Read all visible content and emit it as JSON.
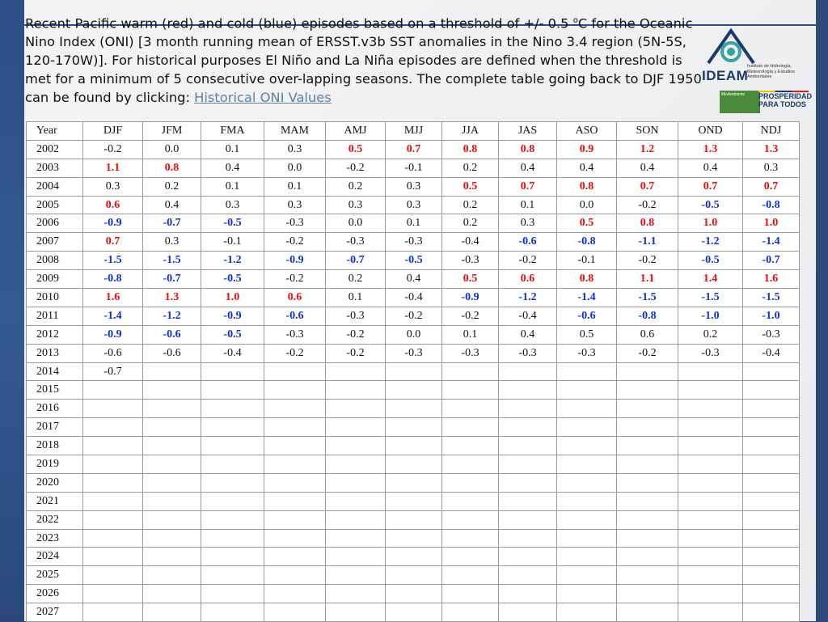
{
  "header": {
    "intro": "Recent Pacific warm (red) and cold (blue) episodes based on a threshold of +/- 0.5 ",
    "degree": "o",
    "rest": "C for the Oceanic Nino Index (ONI) [3 month running mean of ERSST.v3b SST anomalies in the Nino 3.4 region (5N-5S, 120-170W)]. For historical purposes El Niño and La Niña episodes are defined when the threshold is met for a minimum of 5 consecutive over-lapping seasons.  The complete table going back to DJF 1950 can be found by clicking: ",
    "link_label": "Historical ONI Values"
  },
  "logos": {
    "ideam_name": "IDEAM",
    "ideam_sub": "Instituto de Hidrología, Meteorología y Estudios Ambientales",
    "ministry": "MinAmbiente",
    "prosperidad_line1": "PROSPERIDAD",
    "prosperidad_line2": "PARA TODOS"
  },
  "colors": {
    "warm": "#e01010",
    "cold": "#1030d0",
    "link": "#5f7fa3",
    "frame": "#2e4a7a"
  },
  "table": {
    "columns": [
      "Year",
      "DJF",
      "JFM",
      "FMA",
      "MAM",
      "AMJ",
      "MJJ",
      "JJA",
      "JAS",
      "ASO",
      "SON",
      "OND",
      "NDJ"
    ],
    "rows": [
      {
        "year": "2002",
        "cells": [
          [
            "-0.2",
            ""
          ],
          [
            "0.0",
            ""
          ],
          [
            "0.1",
            ""
          ],
          [
            "0.3",
            ""
          ],
          [
            "0.5",
            "warm"
          ],
          [
            "0.7",
            "warm"
          ],
          [
            "0.8",
            "warm"
          ],
          [
            "0.8",
            "warm"
          ],
          [
            "0.9",
            "warm"
          ],
          [
            "1.2",
            "warm"
          ],
          [
            "1.3",
            "warm"
          ],
          [
            "1.3",
            "warm"
          ]
        ]
      },
      {
        "year": "2003",
        "cells": [
          [
            "1.1",
            "warm"
          ],
          [
            "0.8",
            "warm"
          ],
          [
            "0.4",
            ""
          ],
          [
            "0.0",
            ""
          ],
          [
            "-0.2",
            ""
          ],
          [
            "-0.1",
            ""
          ],
          [
            "0.2",
            ""
          ],
          [
            "0.4",
            ""
          ],
          [
            "0.4",
            ""
          ],
          [
            "0.4",
            ""
          ],
          [
            "0.4",
            ""
          ],
          [
            "0.3",
            ""
          ]
        ]
      },
      {
        "year": "2004",
        "cells": [
          [
            "0.3",
            ""
          ],
          [
            "0.2",
            ""
          ],
          [
            "0.1",
            ""
          ],
          [
            "0.1",
            ""
          ],
          [
            "0.2",
            ""
          ],
          [
            "0.3",
            ""
          ],
          [
            "0.5",
            "warm"
          ],
          [
            "0.7",
            "warm"
          ],
          [
            "0.8",
            "warm"
          ],
          [
            "0.7",
            "warm"
          ],
          [
            "0.7",
            "warm"
          ],
          [
            "0.7",
            "warm"
          ]
        ]
      },
      {
        "year": "2005",
        "cells": [
          [
            "0.6",
            "warm"
          ],
          [
            "0.4",
            ""
          ],
          [
            "0.3",
            ""
          ],
          [
            "0.3",
            ""
          ],
          [
            "0.3",
            ""
          ],
          [
            "0.3",
            ""
          ],
          [
            "0.2",
            ""
          ],
          [
            "0.1",
            ""
          ],
          [
            "0.0",
            ""
          ],
          [
            "-0.2",
            ""
          ],
          [
            "-0.5",
            "cold"
          ],
          [
            "-0.8",
            "cold"
          ]
        ]
      },
      {
        "year": "2006",
        "cells": [
          [
            "-0.9",
            "cold"
          ],
          [
            "-0.7",
            "cold"
          ],
          [
            "-0.5",
            "cold"
          ],
          [
            "-0.3",
            ""
          ],
          [
            "0.0",
            ""
          ],
          [
            "0.1",
            ""
          ],
          [
            "0.2",
            ""
          ],
          [
            "0.3",
            ""
          ],
          [
            "0.5",
            "warm"
          ],
          [
            "0.8",
            "warm"
          ],
          [
            "1.0",
            "warm"
          ],
          [
            "1.0",
            "warm"
          ]
        ]
      },
      {
        "year": "2007",
        "cells": [
          [
            "0.7",
            "warm"
          ],
          [
            "0.3",
            ""
          ],
          [
            "-0.1",
            ""
          ],
          [
            "-0.2",
            ""
          ],
          [
            "-0.3",
            ""
          ],
          [
            "-0.3",
            ""
          ],
          [
            "-0.4",
            ""
          ],
          [
            "-0.6",
            "cold"
          ],
          [
            "-0.8",
            "cold"
          ],
          [
            "-1.1",
            "cold"
          ],
          [
            "-1.2",
            "cold"
          ],
          [
            "-1.4",
            "cold"
          ]
        ]
      },
      {
        "year": "2008",
        "cells": [
          [
            "-1.5",
            "cold"
          ],
          [
            "-1.5",
            "cold"
          ],
          [
            "-1.2",
            "cold"
          ],
          [
            "-0.9",
            "cold"
          ],
          [
            "-0.7",
            "cold"
          ],
          [
            "-0.5",
            "cold"
          ],
          [
            "-0.3",
            ""
          ],
          [
            "-0.2",
            ""
          ],
          [
            "-0.1",
            ""
          ],
          [
            "-0.2",
            ""
          ],
          [
            "-0.5",
            "cold"
          ],
          [
            "-0.7",
            "cold"
          ]
        ]
      },
      {
        "year": "2009",
        "cells": [
          [
            "-0.8",
            "cold"
          ],
          [
            "-0.7",
            "cold"
          ],
          [
            "-0.5",
            "cold"
          ],
          [
            "-0.2",
            ""
          ],
          [
            "0.2",
            ""
          ],
          [
            "0.4",
            ""
          ],
          [
            "0.5",
            "warm"
          ],
          [
            "0.6",
            "warm"
          ],
          [
            "0.8",
            "warm"
          ],
          [
            "1.1",
            "warm"
          ],
          [
            "1.4",
            "warm"
          ],
          [
            "1.6",
            "warm"
          ]
        ]
      },
      {
        "year": "2010",
        "cells": [
          [
            "1.6",
            "warm"
          ],
          [
            "1.3",
            "warm"
          ],
          [
            "1.0",
            "warm"
          ],
          [
            "0.6",
            "warm"
          ],
          [
            "0.1",
            ""
          ],
          [
            "-0.4",
            ""
          ],
          [
            "-0.9",
            "cold"
          ],
          [
            "-1.2",
            "cold"
          ],
          [
            "-1.4",
            "cold"
          ],
          [
            "-1.5",
            "cold"
          ],
          [
            "-1.5",
            "cold"
          ],
          [
            "-1.5",
            "cold"
          ]
        ]
      },
      {
        "year": "2011",
        "cells": [
          [
            "-1.4",
            "cold"
          ],
          [
            "-1.2",
            "cold"
          ],
          [
            "-0.9",
            "cold"
          ],
          [
            "-0.6",
            "cold"
          ],
          [
            "-0.3",
            ""
          ],
          [
            "-0.2",
            ""
          ],
          [
            "-0.2",
            ""
          ],
          [
            "-0.4",
            ""
          ],
          [
            "-0.6",
            "cold"
          ],
          [
            "-0.8",
            "cold"
          ],
          [
            "-1.0",
            "cold"
          ],
          [
            "-1.0",
            "cold"
          ]
        ]
      },
      {
        "year": "2012",
        "cells": [
          [
            "-0.9",
            "cold"
          ],
          [
            "-0.6",
            "cold"
          ],
          [
            "-0.5",
            "cold"
          ],
          [
            "-0.3",
            ""
          ],
          [
            "-0.2",
            ""
          ],
          [
            "0.0",
            ""
          ],
          [
            "0.1",
            ""
          ],
          [
            "0.4",
            ""
          ],
          [
            "0.5",
            ""
          ],
          [
            "0.6",
            ""
          ],
          [
            "0.2",
            ""
          ],
          [
            "-0.3",
            ""
          ]
        ]
      },
      {
        "year": "2013",
        "cells": [
          [
            "-0.6",
            ""
          ],
          [
            "-0.6",
            ""
          ],
          [
            "-0.4",
            ""
          ],
          [
            "-0.2",
            ""
          ],
          [
            "-0.2",
            ""
          ],
          [
            "-0.3",
            ""
          ],
          [
            "-0.3",
            ""
          ],
          [
            "-0.3",
            ""
          ],
          [
            "-0.3",
            ""
          ],
          [
            "-0.2",
            ""
          ],
          [
            "-0.3",
            ""
          ],
          [
            "-0.4",
            ""
          ]
        ]
      },
      {
        "year": "2014",
        "cells": [
          [
            "-0.7",
            ""
          ],
          [
            "",
            ""
          ],
          [
            "",
            ""
          ],
          [
            "",
            ""
          ],
          [
            "",
            ""
          ],
          [
            "",
            ""
          ],
          [
            "",
            ""
          ],
          [
            "",
            ""
          ],
          [
            "",
            ""
          ],
          [
            "",
            ""
          ],
          [
            "",
            ""
          ],
          [
            "",
            ""
          ]
        ]
      },
      {
        "year": "2015",
        "cells": []
      },
      {
        "year": "2016",
        "cells": []
      },
      {
        "year": "2017",
        "cells": []
      },
      {
        "year": "2018",
        "cells": []
      },
      {
        "year": "2019",
        "cells": []
      },
      {
        "year": "2020",
        "cells": []
      },
      {
        "year": "2021",
        "cells": []
      },
      {
        "year": "2022",
        "cells": []
      },
      {
        "year": "2023",
        "cells": []
      },
      {
        "year": "2024",
        "cells": []
      },
      {
        "year": "2025",
        "cells": []
      },
      {
        "year": "2026",
        "cells": []
      },
      {
        "year": "2027",
        "cells": []
      }
    ]
  }
}
